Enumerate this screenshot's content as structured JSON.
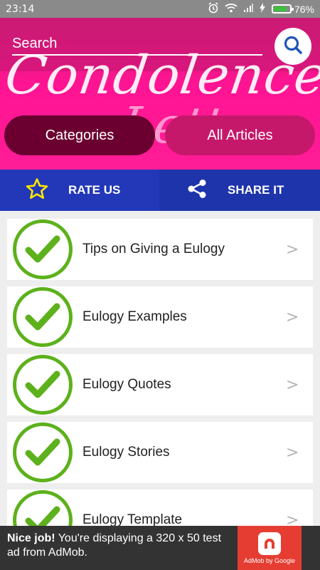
{
  "status_bar": {
    "time": "23:14",
    "battery_percent": "76%",
    "battery_level": 0.76
  },
  "header": {
    "logo_line1": "Condolence",
    "logo_line2": "Letter",
    "search_placeholder": "Search",
    "categories_label": "Categories",
    "all_articles_label": "All Articles"
  },
  "actions": {
    "rate_label": "RATE US",
    "share_label": "SHARE IT"
  },
  "list": {
    "items": [
      {
        "label": "Tips on Giving a Eulogy",
        "chevron": ">"
      },
      {
        "label": "Eulogy Examples",
        "chevron": ">"
      },
      {
        "label": "Eulogy Quotes",
        "chevron": ">"
      },
      {
        "label": "Eulogy Stories",
        "chevron": ">"
      },
      {
        "label": "Eulogy Template",
        "chevron": ">"
      }
    ]
  },
  "ad": {
    "headline": "Nice job!",
    "body": "You're displaying a 320 x 50 test ad from AdMob.",
    "badge": "AdMob by Google"
  },
  "colors": {
    "header_pink": "#ff1493",
    "categories_pill": "#6b0030",
    "action_blue": "#2238b8",
    "check_green": "#5db11c",
    "star_yellow": "#ffe600"
  },
  "icons": {
    "search": "search-icon",
    "star": "star-icon",
    "share": "share-icon",
    "check": "check-icon"
  }
}
